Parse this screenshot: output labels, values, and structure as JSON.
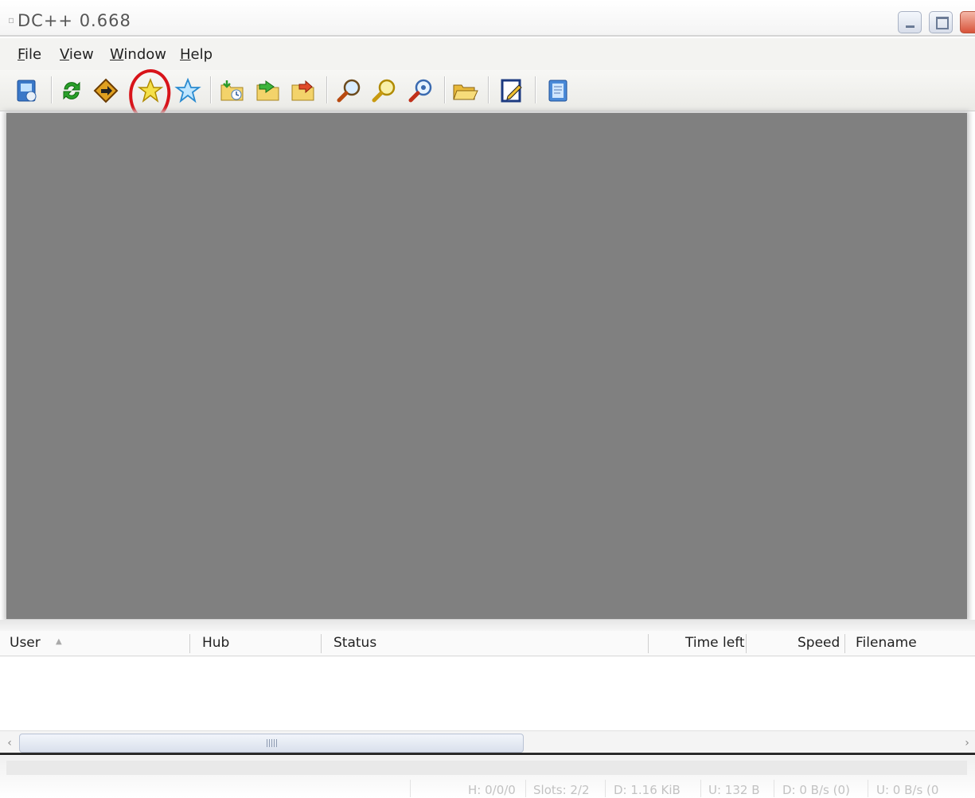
{
  "window": {
    "title": "DC++ 0.668",
    "app_icon": "dcpp-app-icon"
  },
  "menu": {
    "file": "File",
    "view": "View",
    "window": "Window",
    "help": "Help"
  },
  "toolbar": {
    "buttons": [
      "public-hubs-icon",
      "reconnect-icon",
      "follow-redirect-icon",
      "favorite-hubs-icon",
      "favorite-users-icon",
      "download-queue-icon",
      "finished-downloads-icon",
      "finished-uploads-icon",
      "search-icon",
      "adl-search-icon",
      "search-spy-icon",
      "open-file-list-icon",
      "settings-icon",
      "notepad-icon"
    ],
    "highlighted": "favorite-hubs-icon",
    "highlight_color": "#d8141a"
  },
  "transfers": {
    "columns": {
      "user": "User",
      "hub": "Hub",
      "status": "Status",
      "time_left": "Time left",
      "speed": "Speed",
      "filename": "Filename"
    },
    "sort_column": "User"
  },
  "statusbar": {
    "hubs": "H: 0/0/0",
    "slots": "Slots: 2/2",
    "downloaded": "D: 1.16 KiB",
    "uploaded": "U: 132 B",
    "download_rate": "D: 0 B/s (0)",
    "upload_rate": "U: 0 B/s (0"
  },
  "colors": {
    "mdi_background": "#808080",
    "toolbar_bg": "#efefeb"
  }
}
